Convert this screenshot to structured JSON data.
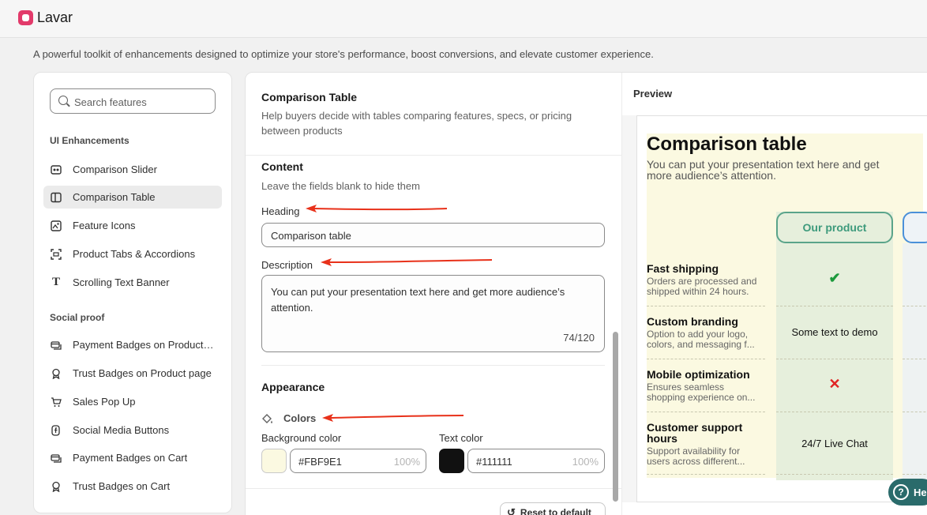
{
  "app": {
    "name": "Lavar"
  },
  "page": {
    "description": "A powerful toolkit of enhancements designed to optimize your store's performance, boost conversions, and elevate customer experience."
  },
  "sidebar": {
    "search_placeholder": "Search features",
    "sections": [
      {
        "title": "UI Enhancements",
        "items": [
          {
            "label": "Comparison Slider",
            "icon": "slider-icon"
          },
          {
            "label": "Comparison Table",
            "icon": "table-icon",
            "active": true
          },
          {
            "label": "Feature Icons",
            "icon": "feature-icons-icon"
          },
          {
            "label": "Product Tabs & Accordions",
            "icon": "tabs-icon"
          },
          {
            "label": "Scrolling Text Banner",
            "icon": "text-icon"
          }
        ]
      },
      {
        "title": "Social proof",
        "items": [
          {
            "label": "Payment Badges on Product page",
            "icon": "payment-icon"
          },
          {
            "label": "Trust Badges on Product page",
            "icon": "badge-icon"
          },
          {
            "label": "Sales Pop Up",
            "icon": "cart-icon"
          },
          {
            "label": "Social Media Buttons",
            "icon": "social-icon"
          },
          {
            "label": "Payment Badges on Cart",
            "icon": "payment-icon"
          },
          {
            "label": "Trust Badges on Cart",
            "icon": "badge-icon"
          }
        ]
      }
    ]
  },
  "settings": {
    "title": "Comparison Table",
    "description": "Help buyers decide with tables comparing features, specs, or pricing between products",
    "content_title": "Content",
    "content_hint": "Leave the fields blank to hide them",
    "heading_label": "Heading",
    "heading_value": "Comparison table",
    "description_label": "Description",
    "description_value": "You can put your presentation text here and get more audience’s attention.",
    "description_counter": "74/120",
    "appearance_title": "Appearance",
    "colors_label": "Colors",
    "bg_color_label": "Background color",
    "bg_color_value": "#FBF9E1",
    "bg_color_opacity": "100%",
    "text_color_label": "Text color",
    "text_color_value": "#111111",
    "text_color_opacity": "100%",
    "reset_label": "Reset to default"
  },
  "preview": {
    "title": "Preview",
    "heading": "Comparison table",
    "description": "You can put your presentation text here and get more audience’s attention.",
    "our_product": "Our product",
    "rows": [
      {
        "title": "Fast shipping",
        "subtitle": "Orders are processed and shipped within 24 hours.",
        "cell": "check"
      },
      {
        "title": "Custom branding",
        "subtitle": "Option to add your logo, colors, and messaging f...",
        "cell": "Some text to demo"
      },
      {
        "title": "Mobile optimization",
        "subtitle": "Ensures seamless shopping experience on...",
        "cell": "cross"
      },
      {
        "title": "Customer support hours",
        "subtitle": "Support availability for users across different...",
        "cell": "24/7 Live Chat"
      }
    ]
  },
  "help": {
    "label": "He"
  },
  "colors": {
    "accent_red": "#e8311a",
    "bg_swatch": "#FBF9E1",
    "text_swatch": "#111111",
    "our_product_border": "#5aa48a"
  }
}
